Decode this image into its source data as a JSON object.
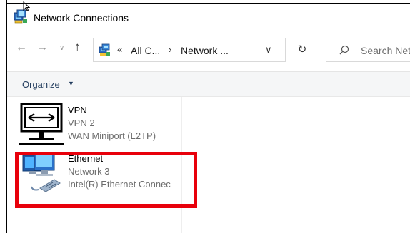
{
  "window": {
    "title": "Network Connections"
  },
  "nav": {
    "back_glyph": "←",
    "forward_glyph": "→",
    "recent_glyph": "∨",
    "up_glyph": "↑",
    "refresh_glyph": "↻"
  },
  "address": {
    "overflow": "«",
    "crumb1": "All C...",
    "separator": "›",
    "crumb2": "Network ...",
    "dropdown_glyph": "∨"
  },
  "search": {
    "placeholder": "Search Net"
  },
  "commandbar": {
    "organize_label": "Organize",
    "organize_caret": "▼"
  },
  "connections": [
    {
      "name": "VPN",
      "network": "VPN  2",
      "device": "WAN Miniport (L2TP)",
      "icon": "vpn-monitor-icon"
    },
    {
      "name": "Ethernet",
      "network": "Network 3",
      "device": "Intel(R) Ethernet Connec",
      "icon": "ethernet-adapter-icon"
    }
  ],
  "colors": {
    "highlight": "#e8000b",
    "organize_text": "#1e395b",
    "secondary_text": "#6d6d6d"
  }
}
